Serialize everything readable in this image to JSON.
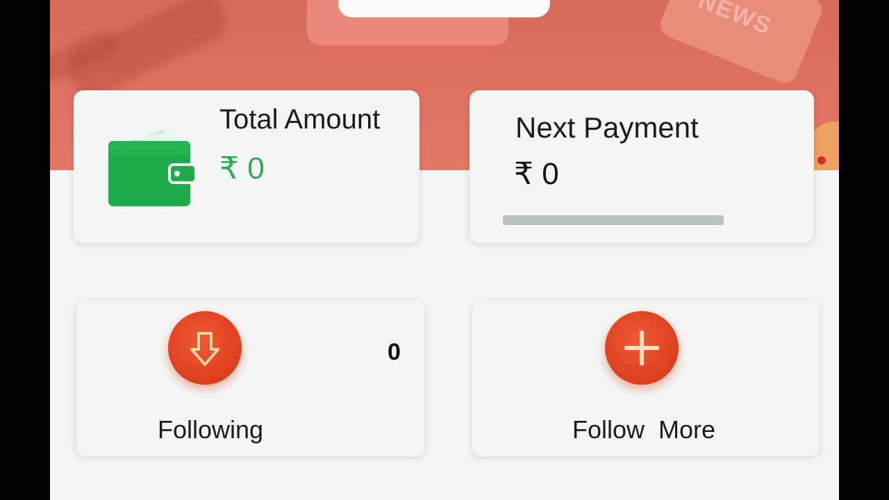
{
  "banner": {
    "news_text": "NEWS"
  },
  "total_amount": {
    "label": "Total Amount",
    "value": "₹ 0",
    "icon": "wallet-icon",
    "color": "#2eab52"
  },
  "next_payment": {
    "label": "Next Payment",
    "value": "₹ 0",
    "progress": 0
  },
  "following": {
    "label": "Following",
    "count": "0",
    "icon": "arrow-down-icon"
  },
  "follow_more": {
    "label": "Follow  More",
    "icon": "plus-icon"
  },
  "colors": {
    "accent": "#dd3f1d",
    "banner": "#e07262",
    "wallet_green": "#1faa4b"
  }
}
